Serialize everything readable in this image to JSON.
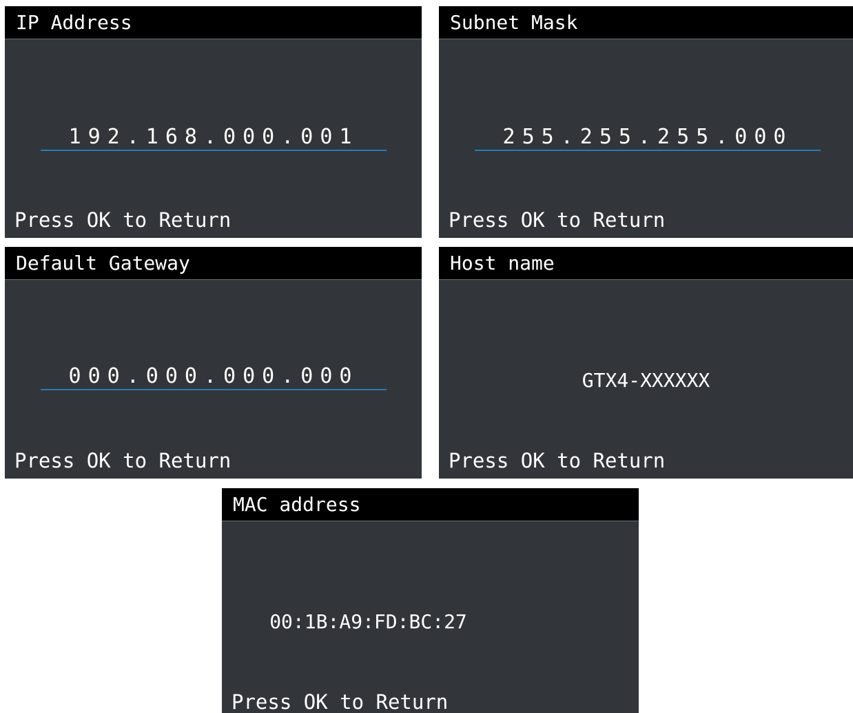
{
  "screens": {
    "ip_address": {
      "title": "IP Address",
      "value": "192.168.000.001",
      "footer": "Press OK to Return"
    },
    "subnet_mask": {
      "title": "Subnet Mask",
      "value": "255.255.255.000",
      "footer": "Press OK to Return"
    },
    "default_gateway": {
      "title": "Default Gateway",
      "value": "000.000.000.000",
      "footer": "Press OK to Return"
    },
    "host_name": {
      "title": "Host name",
      "value": "GTX4-XXXXXX",
      "footer": "Press OK to Return"
    },
    "mac_address": {
      "title": "MAC address",
      "value": "00:1B:A9:FD:BC:27",
      "footer": "Press OK to Return"
    }
  },
  "colors": {
    "screen_bg": "#32353a",
    "titlebar_bg": "#000000",
    "text": "#ffffff",
    "underline_accent": "#1f7fb8"
  }
}
